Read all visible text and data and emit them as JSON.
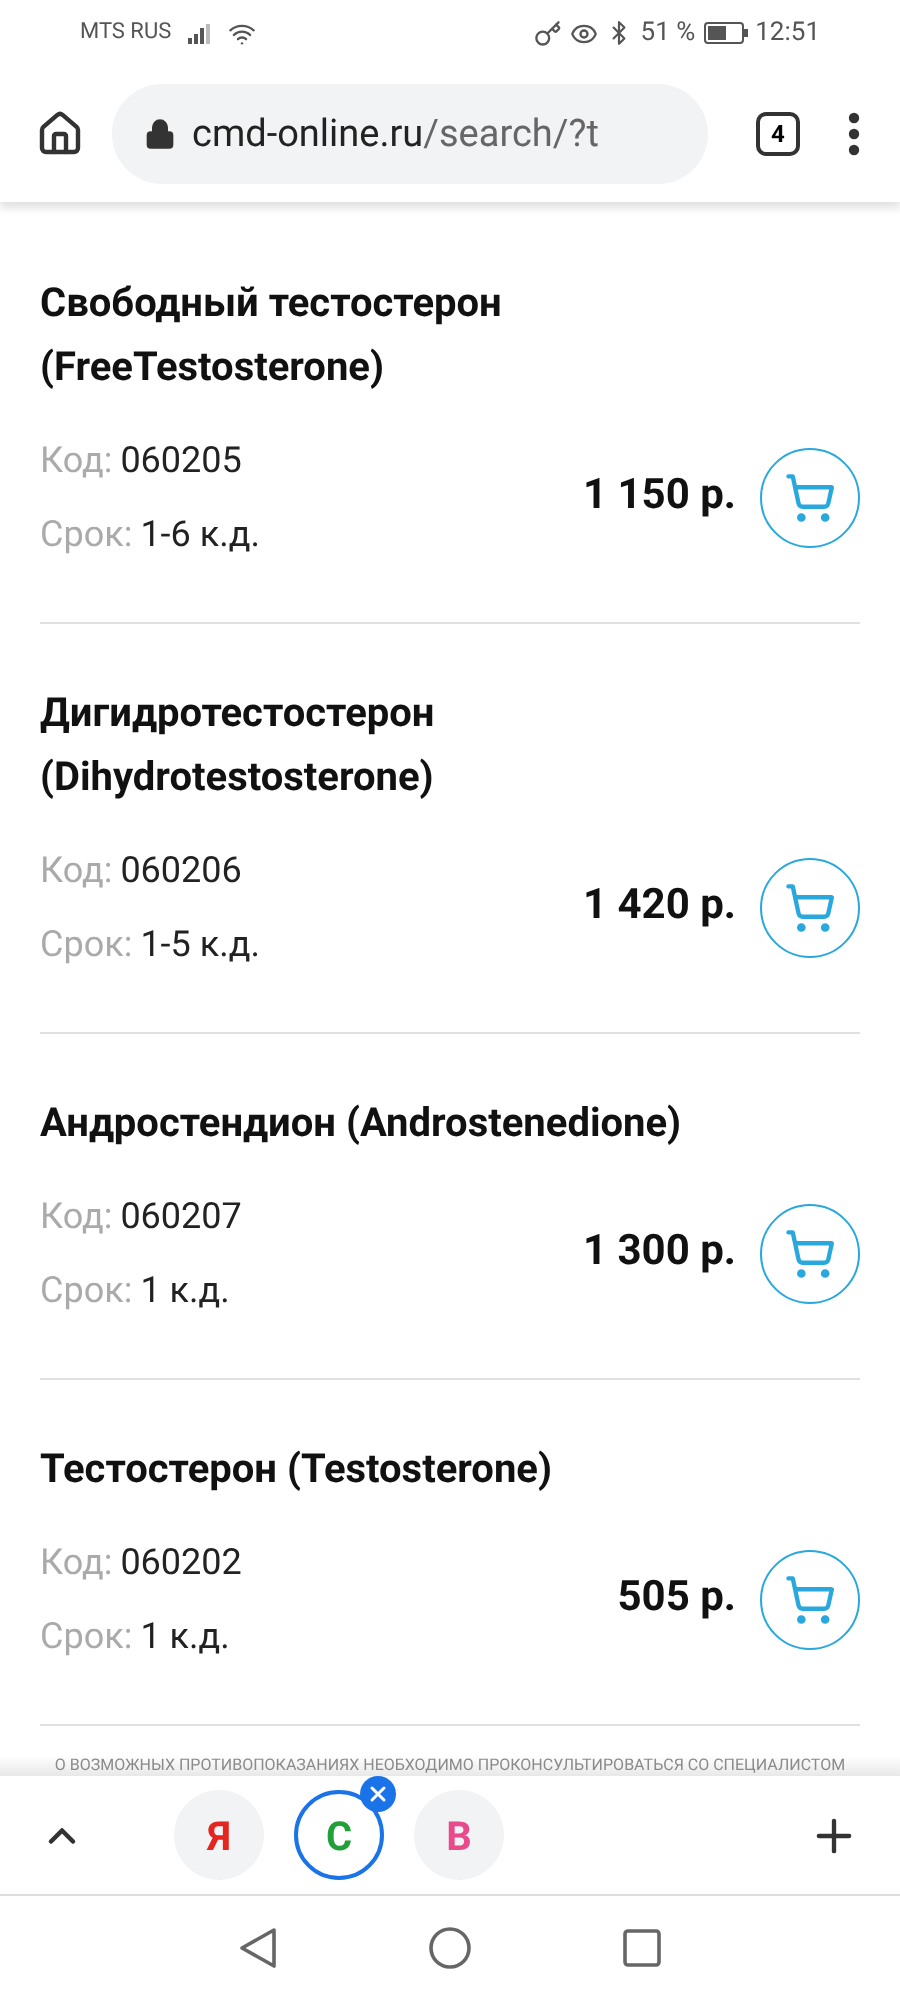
{
  "status_bar": {
    "carrier": "MTS RUS",
    "battery_percent": "51 %",
    "time": "12:51"
  },
  "browser": {
    "url_host": "cmd-online.ru",
    "url_path": "/search/?t",
    "tab_count": "4"
  },
  "products": [
    {
      "title": "Свободный тестостерон (FreeTestosterone)",
      "code_label": "Код:",
      "code": "060205",
      "term_label": "Срок:",
      "term": "1-6 к.д.",
      "price": "1 150 р."
    },
    {
      "title": "Дигидротестостерон (Dihydrotestosterone)",
      "code_label": "Код:",
      "code": "060206",
      "term_label": "Срок:",
      "term": "1-5 к.д.",
      "price": "1 420 р."
    },
    {
      "title": "Андростендион (Androstenedione)",
      "code_label": "Код:",
      "code": "060207",
      "term_label": "Срок:",
      "term": "1 к.д.",
      "price": "1 300 р."
    },
    {
      "title": "Тестостерон (Testosterone)",
      "code_label": "Код:",
      "code": "060202",
      "term_label": "Срок:",
      "term": "1 к.д.",
      "price": "505 р."
    }
  ],
  "disclaimer": "О ВОЗМОЖНЫХ ПРОТИВОПОКАЗАНИЯХ НЕОБХОДИМО ПРОКОНСУЛЬТИРОВАТЬСЯ СО СПЕЦИАЛИСТОМ",
  "tab_group": [
    {
      "letter": "Я",
      "color": "#e52620",
      "selected": false
    },
    {
      "letter": "С",
      "color": "#21a038",
      "selected": true
    },
    {
      "letter": "В",
      "color": "#e94a8c",
      "selected": false
    }
  ]
}
